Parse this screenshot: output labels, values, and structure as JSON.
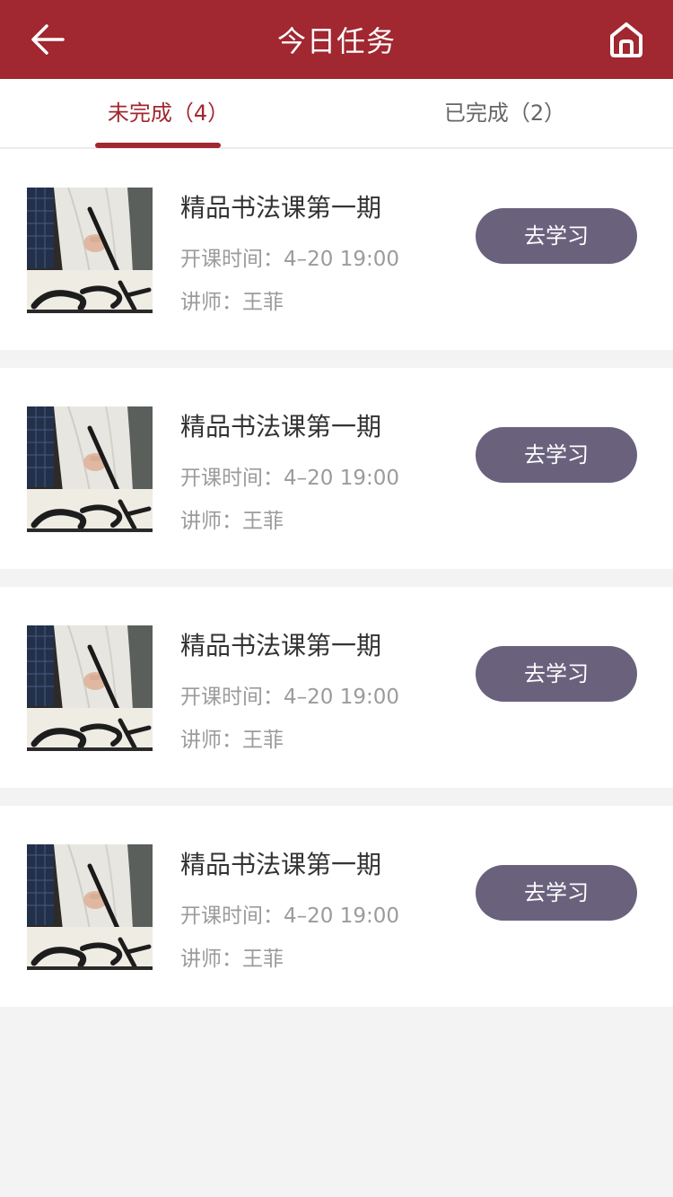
{
  "header": {
    "title": "今日任务",
    "back_icon": "arrow-left-icon",
    "home_icon": "home-icon"
  },
  "tabs": [
    {
      "label": "未完成（4）",
      "active": true
    },
    {
      "label": "已完成（2）",
      "active": false
    }
  ],
  "courses": [
    {
      "title": "精品书法课第一期",
      "time": "开课时间：4–20 19:00",
      "teacher": "讲师：王菲",
      "button": "去学习"
    },
    {
      "title": "精品书法课第一期",
      "time": "开课时间：4–20 19:00",
      "teacher": "讲师：王菲",
      "button": "去学习"
    },
    {
      "title": "精品书法课第一期",
      "time": "开课时间：4–20 19:00",
      "teacher": "讲师：王菲",
      "button": "去学习"
    },
    {
      "title": "精品书法课第一期",
      "time": "开课时间：4–20 19:00",
      "teacher": "讲师：王菲",
      "button": "去学习"
    }
  ],
  "colors": {
    "brand": "#a12730",
    "button": "#6a627d",
    "page_bg": "#f2f3f2"
  }
}
